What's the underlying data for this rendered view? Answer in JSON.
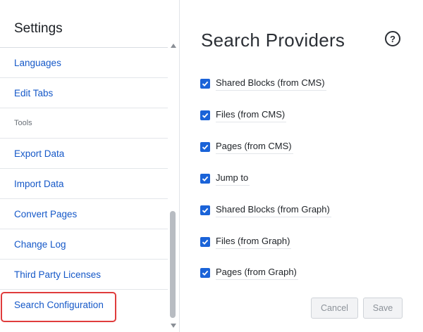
{
  "sidebar": {
    "title": "Settings",
    "items": [
      {
        "label": "Languages"
      },
      {
        "label": "Edit Tabs"
      },
      {
        "section": "Tools"
      },
      {
        "label": "Export Data"
      },
      {
        "label": "Import Data"
      },
      {
        "label": "Convert Pages"
      },
      {
        "label": "Change Log"
      },
      {
        "label": "Third Party Licenses"
      },
      {
        "label": "Search Configuration"
      }
    ]
  },
  "main": {
    "title": "Search Providers",
    "help_icon": "help-circle-icon",
    "providers": [
      {
        "label": "Shared Blocks (from CMS)",
        "checked": true
      },
      {
        "label": "Files (from CMS)",
        "checked": true
      },
      {
        "label": "Pages (from CMS)",
        "checked": true
      },
      {
        "label": "Jump to",
        "checked": true
      },
      {
        "label": "Shared Blocks (from Graph)",
        "checked": true
      },
      {
        "label": "Files (from Graph)",
        "checked": true
      },
      {
        "label": "Pages (from Graph)",
        "checked": true
      }
    ],
    "buttons": {
      "cancel": "Cancel",
      "save": "Save"
    }
  },
  "colors": {
    "accent": "#1a63d8",
    "link": "#1558c8",
    "highlight": "#e03c3c"
  }
}
